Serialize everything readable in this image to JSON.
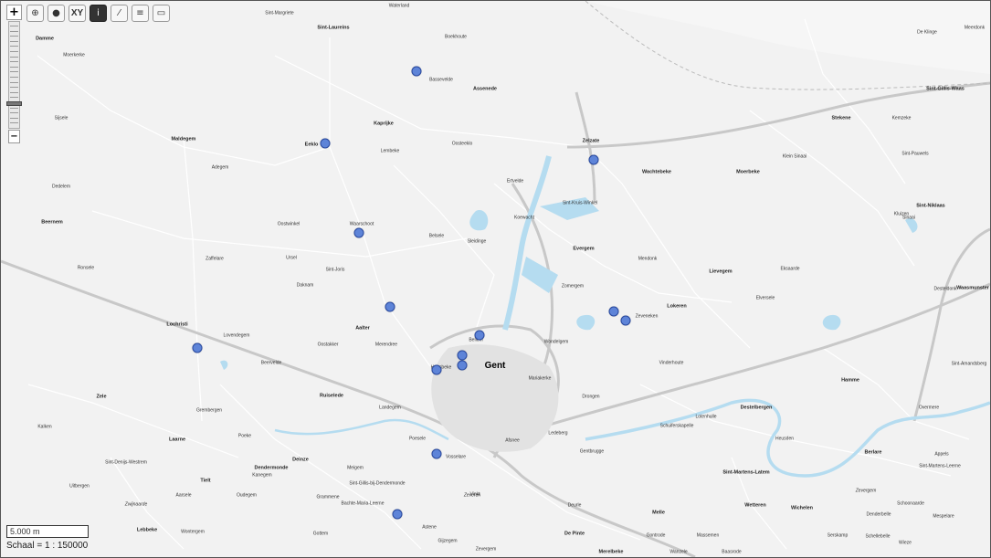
{
  "toolbar": {
    "buttons": [
      {
        "name": "zoom-in-tool-button",
        "icon": "magnifier-plus-icon",
        "glyph": "⊕",
        "active": false
      },
      {
        "name": "globe-tool-button",
        "icon": "globe-icon",
        "glyph": "●",
        "active": false
      },
      {
        "name": "xy-tool-button",
        "icon": "",
        "label": "XY",
        "active": false
      },
      {
        "name": "info-tool-button",
        "icon": "info-icon",
        "glyph": "i",
        "active": true
      },
      {
        "name": "measure-tool-button",
        "icon": "ruler-icon",
        "glyph": "⁄",
        "active": false
      },
      {
        "name": "print-tool-button",
        "icon": "pin-tool-icon",
        "glyph": "≡",
        "active": false
      },
      {
        "name": "layers-tool-button",
        "icon": "folder-icon",
        "glyph": "▭",
        "active": false
      }
    ]
  },
  "zoom": {
    "in_label": "+",
    "out_label": "−"
  },
  "scale": {
    "bar_label": "5.000 m",
    "text": "Schaal = 1 : 150000"
  },
  "map": {
    "colors": {
      "land": "#f2f2f2",
      "water": "#b5dcf0",
      "road": "#ffffff",
      "highway": "#c9c9c9",
      "marker": "#5e84d8"
    },
    "labels": [
      {
        "text": "Gent",
        "cls": "city"
      },
      {
        "text": "Sint-Margriete",
        "cls": "sm"
      },
      {
        "text": "Waterland",
        "cls": "sm"
      },
      {
        "text": "Sint-Laureins",
        "cls": "med"
      },
      {
        "text": "Damme",
        "cls": "med"
      },
      {
        "text": "Moerkerke",
        "cls": "sm"
      },
      {
        "text": "Boekhoute",
        "cls": "sm"
      },
      {
        "text": "Bassevelde",
        "cls": "sm"
      },
      {
        "text": "Assenede",
        "cls": "med"
      },
      {
        "text": "De Klinge",
        "cls": "sm"
      },
      {
        "text": "Meerdonk",
        "cls": "sm"
      },
      {
        "text": "Sint-Gillis-Waas",
        "cls": "med"
      },
      {
        "text": "Sijsele",
        "cls": "sm"
      },
      {
        "text": "Maldegem",
        "cls": "med"
      },
      {
        "text": "Kaprijke",
        "cls": "med"
      },
      {
        "text": "Eeklo",
        "cls": "med"
      },
      {
        "text": "Lembeke",
        "cls": "sm"
      },
      {
        "text": "Oosteeklo",
        "cls": "sm"
      },
      {
        "text": "Zelzate",
        "cls": "med"
      },
      {
        "text": "Stekene",
        "cls": "med"
      },
      {
        "text": "Kemzeke",
        "cls": "sm"
      },
      {
        "text": "Sint-Pauwels",
        "cls": "sm"
      },
      {
        "text": "Adegem",
        "cls": "sm"
      },
      {
        "text": "Wachtebeke",
        "cls": "med"
      },
      {
        "text": "Moerbeke",
        "cls": "med"
      },
      {
        "text": "Klein Sinaai",
        "cls": "sm"
      },
      {
        "text": "Dedelem",
        "cls": "sm"
      },
      {
        "text": "Ertvelde",
        "cls": "sm"
      },
      {
        "text": "Sint-Kruis-Winkel",
        "cls": "sm"
      },
      {
        "text": "Koewacht",
        "cls": "sm"
      },
      {
        "text": "Sint-Niklaas",
        "cls": "med"
      },
      {
        "text": "Beernem",
        "cls": "med"
      },
      {
        "text": "Oostwinkel",
        "cls": "sm"
      },
      {
        "text": "Waarschoot",
        "cls": "sm"
      },
      {
        "text": "Kluizen",
        "cls": "sm"
      },
      {
        "text": "Sinaai",
        "cls": "sm"
      },
      {
        "text": "Belsele",
        "cls": "sm"
      },
      {
        "text": "Sleidinge",
        "cls": "sm"
      },
      {
        "text": "Evergem",
        "cls": "med"
      },
      {
        "text": "Mendonk",
        "cls": "sm"
      },
      {
        "text": "Zaffelare",
        "cls": "sm"
      },
      {
        "text": "Ursel",
        "cls": "sm"
      },
      {
        "text": "Ronsele",
        "cls": "sm"
      },
      {
        "text": "Sint-Joris",
        "cls": "sm"
      },
      {
        "text": "Lievegem",
        "cls": "med"
      },
      {
        "text": "Eksaarde",
        "cls": "sm"
      },
      {
        "text": "Daknam",
        "cls": "sm"
      },
      {
        "text": "Zomergem",
        "cls": "sm"
      },
      {
        "text": "Desteldonk",
        "cls": "sm"
      },
      {
        "text": "Waasmunster",
        "cls": "med"
      },
      {
        "text": "Elversele",
        "cls": "sm"
      },
      {
        "text": "Lokeren",
        "cls": "med"
      },
      {
        "text": "Zeveneken",
        "cls": "sm"
      },
      {
        "text": "Lochristi",
        "cls": "med"
      },
      {
        "text": "Aalter",
        "cls": "med"
      },
      {
        "text": "Lovendegem",
        "cls": "sm"
      },
      {
        "text": "Bellem",
        "cls": "sm"
      },
      {
        "text": "Wondelgem",
        "cls": "sm"
      },
      {
        "text": "Oostakker",
        "cls": "sm"
      },
      {
        "text": "Merendree",
        "cls": "sm"
      },
      {
        "text": "Vinderhoute",
        "cls": "sm"
      },
      {
        "text": "Beervelde",
        "cls": "sm"
      },
      {
        "text": "Hansbeke",
        "cls": "sm"
      },
      {
        "text": "Mariakerke",
        "cls": "sm"
      },
      {
        "text": "Sint-Amandsberg",
        "cls": "sm"
      },
      {
        "text": "Hamme",
        "cls": "med"
      },
      {
        "text": "Zele",
        "cls": "med"
      },
      {
        "text": "Ruiselede",
        "cls": "med"
      },
      {
        "text": "Landegem",
        "cls": "sm"
      },
      {
        "text": "Drongen",
        "cls": "sm"
      },
      {
        "text": "Destelbergen",
        "cls": "med"
      },
      {
        "text": "Overmere",
        "cls": "sm"
      },
      {
        "text": "Grembergen",
        "cls": "sm"
      },
      {
        "text": "Lotenhulle",
        "cls": "sm"
      },
      {
        "text": "Kalken",
        "cls": "sm"
      },
      {
        "text": "Schuiferskapelle",
        "cls": "sm"
      },
      {
        "text": "Laarne",
        "cls": "med"
      },
      {
        "text": "Poeke",
        "cls": "sm"
      },
      {
        "text": "Poesele",
        "cls": "sm"
      },
      {
        "text": "Afsnee",
        "cls": "sm"
      },
      {
        "text": "Ledeberg",
        "cls": "sm"
      },
      {
        "text": "Gentbrugge",
        "cls": "sm"
      },
      {
        "text": "Heusden",
        "cls": "sm"
      },
      {
        "text": "Berlare",
        "cls": "med"
      },
      {
        "text": "Appels",
        "cls": "sm"
      },
      {
        "text": "Dendermonde",
        "cls": "med"
      },
      {
        "text": "Deinze",
        "cls": "med"
      },
      {
        "text": "Vosselare",
        "cls": "sm"
      },
      {
        "text": "Sint-Denijs-Westrem",
        "cls": "sm"
      },
      {
        "text": "Kanegem",
        "cls": "sm"
      },
      {
        "text": "Meigem",
        "cls": "sm"
      },
      {
        "text": "Sint-Martens-Leerne",
        "cls": "sm"
      },
      {
        "text": "Sint-Gillis-bij-Dendermonde",
        "cls": "sm"
      },
      {
        "text": "Sint-Martens-Latem",
        "cls": "med"
      },
      {
        "text": "Uitbergen",
        "cls": "sm"
      },
      {
        "text": "Tielt",
        "cls": "med"
      },
      {
        "text": "Vinkt",
        "cls": "sm"
      },
      {
        "text": "Zevergem",
        "cls": "it"
      },
      {
        "text": "Oudegem",
        "cls": "sm"
      },
      {
        "text": "Zeveren",
        "cls": "it"
      },
      {
        "text": "Zwijnaarde",
        "cls": "it"
      },
      {
        "text": "Aarsele",
        "cls": "sm"
      },
      {
        "text": "Grammene",
        "cls": "sm"
      },
      {
        "text": "Bachte-Maria-Leerne",
        "cls": "sm"
      },
      {
        "text": "Deurle",
        "cls": "sm"
      },
      {
        "text": "Melle",
        "cls": "med"
      },
      {
        "text": "Wetteren",
        "cls": "med"
      },
      {
        "text": "Wichelen",
        "cls": "med"
      },
      {
        "text": "Schoonaarde",
        "cls": "sm"
      },
      {
        "text": "Denderbelle",
        "cls": "sm"
      },
      {
        "text": "Mespelare",
        "cls": "sm"
      },
      {
        "text": "Lebbeke",
        "cls": "med"
      },
      {
        "text": "Wontergem",
        "cls": "sm"
      },
      {
        "text": "Gottem",
        "cls": "sm"
      },
      {
        "text": "Astene",
        "cls": "sm"
      },
      {
        "text": "De Pinte",
        "cls": "med"
      },
      {
        "text": "Gontrode",
        "cls": "sm"
      },
      {
        "text": "Massemen",
        "cls": "sm"
      },
      {
        "text": "Serskamp",
        "cls": "sm"
      },
      {
        "text": "Gijzegem",
        "cls": "sm"
      },
      {
        "text": "Zevergem",
        "cls": "sm"
      },
      {
        "text": "Merelbeke",
        "cls": "med"
      },
      {
        "text": "Wanzele",
        "cls": "sm"
      },
      {
        "text": "Schellebelle",
        "cls": "sm"
      },
      {
        "text": "Wieze",
        "cls": "sm"
      },
      {
        "text": "Baasrode",
        "cls": "sm"
      }
    ]
  }
}
